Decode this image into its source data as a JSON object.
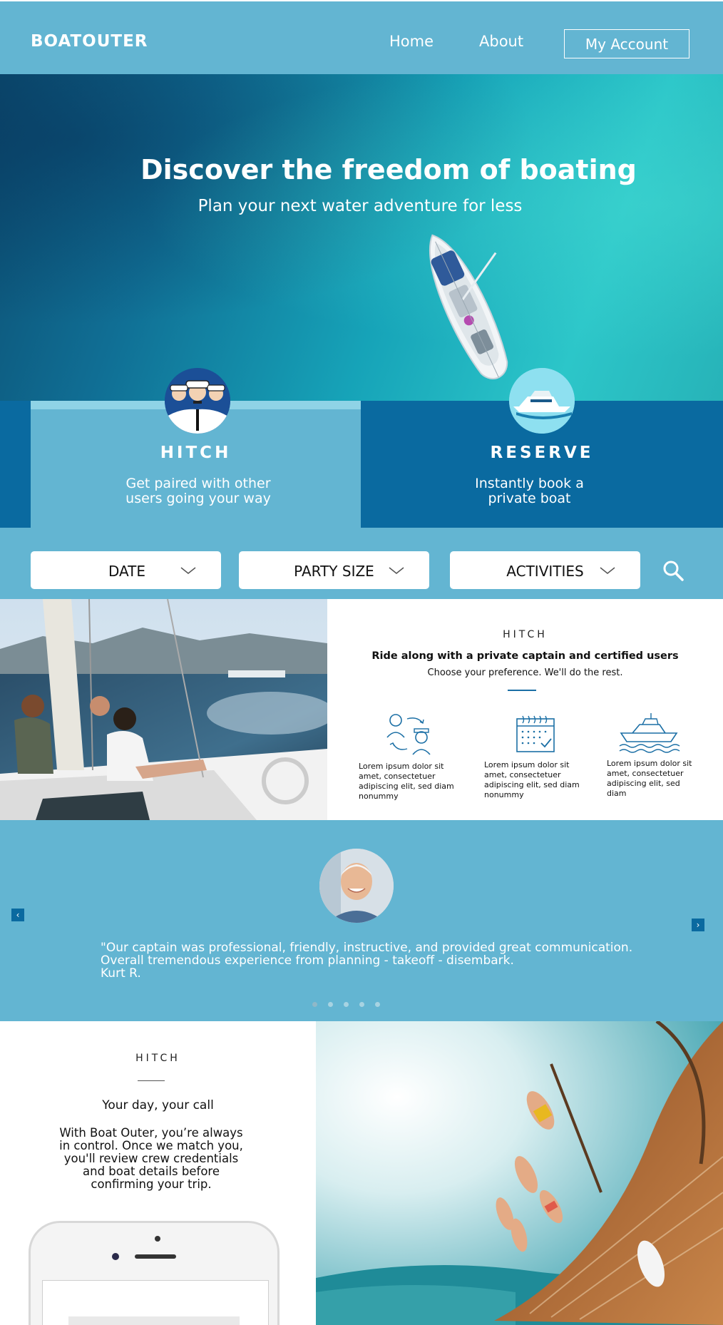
{
  "nav": {
    "logo": "BOATOUTER",
    "links": [
      {
        "label": "Home"
      },
      {
        "label": "About"
      }
    ],
    "account_label": "My Account"
  },
  "hero": {
    "title": "Discover the freedom of boating",
    "subtitle": "Plan your next water adventure for less"
  },
  "features": [
    {
      "title": "HITCH",
      "text": "Get paired with other users going your way",
      "icon": "crew-icon"
    },
    {
      "title": "RESERVE",
      "text": "Instantly book a private boat",
      "icon": "yacht-icon"
    }
  ],
  "search": {
    "filters": [
      {
        "label": "DATE"
      },
      {
        "label": "PARTY SIZE"
      },
      {
        "label": "ACTIVITIES"
      }
    ],
    "icon": "search-icon"
  },
  "hitch_info": {
    "kicker": "HITCH",
    "heading": "Ride along with a private captain and certified users",
    "subheading": "Choose your preference. We'll do the rest.",
    "items": [
      {
        "icon": "captain-swap-icon",
        "text": "Lorem ipsum dolor sit amet, consectetuer adipiscing elit, sed diam nonummy"
      },
      {
        "icon": "calendar-icon",
        "text": "Lorem ipsum dolor sit amet, consectetuer adipiscing elit, sed diam nonummy"
      },
      {
        "icon": "boat-icon",
        "text": "Lorem ipsum dolor sit amet, consectetuer adipiscing elit, sed diam"
      }
    ]
  },
  "testimonial": {
    "quote": "\"Our captain was professional, friendly, instructive, and provided great communication. Overall tremendous experience from planning - takeoff - disembark.",
    "author": "Kurt R.",
    "prev": "‹",
    "next": "›",
    "dots": 5,
    "active_dot": 0
  },
  "bottom": {
    "kicker": "HITCH",
    "title": "Your day, your call",
    "text": "With Boat Outer, you’re always in control. Once we match you, you'll review crew credentials and boat details before confirming your trip."
  },
  "colors": {
    "nav_bg": "#63b5d2",
    "dark_blue": "#0a6aa0",
    "accent_line": "#1b6fa5"
  }
}
